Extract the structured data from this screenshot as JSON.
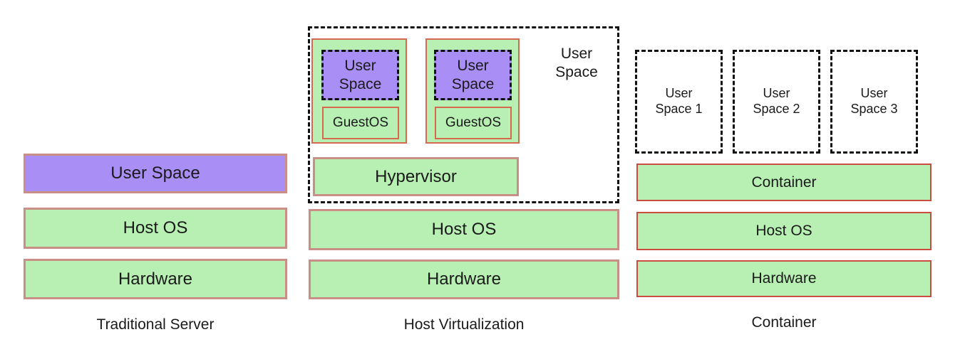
{
  "diagram": {
    "title_visible": false,
    "colors": {
      "green_fill": "#b8f0b4",
      "purple_fill": "#a88ef5",
      "rose_border": "#c98e85",
      "red_border": "#cc4b41",
      "orange_border": "#d4694f",
      "dashed_border": "#111111",
      "background": "#ffffff",
      "text": "#1a1a1a"
    },
    "columns": [
      {
        "id": "traditional-server",
        "caption": "Traditional Server",
        "layers": [
          {
            "label": "User Space",
            "style": "purple"
          },
          {
            "label": "Host OS",
            "style": "green"
          },
          {
            "label": "Hardware",
            "style": "green"
          }
        ]
      },
      {
        "id": "host-virtualization",
        "caption": "Host Virtualization",
        "user_space_region_label": "User\nSpace",
        "user_space_region_label_line1": "User",
        "user_space_region_label_line2": "Space",
        "vms": [
          {
            "id": "vm-1",
            "user_space_line1": "User",
            "user_space_line2": "Space",
            "guest_os": "GuestOS"
          },
          {
            "id": "vm-2",
            "user_space_line1": "User",
            "user_space_line2": "Space",
            "guest_os": "GuestOS"
          }
        ],
        "layers": [
          {
            "label": "Hypervisor",
            "style": "green"
          },
          {
            "label": "Host OS",
            "style": "green"
          },
          {
            "label": "Hardware",
            "style": "green"
          }
        ]
      },
      {
        "id": "container",
        "caption": "Container",
        "user_spaces": [
          {
            "line1": "User",
            "line2": "Space 1"
          },
          {
            "line1": "User",
            "line2": "Space 2"
          },
          {
            "line1": "User",
            "line2": "Space 3"
          }
        ],
        "layers": [
          {
            "label": "Container",
            "style": "green-thin"
          },
          {
            "label": "Host OS",
            "style": "green-thin"
          },
          {
            "label": "Hardware",
            "style": "green-thin"
          }
        ]
      }
    ]
  }
}
